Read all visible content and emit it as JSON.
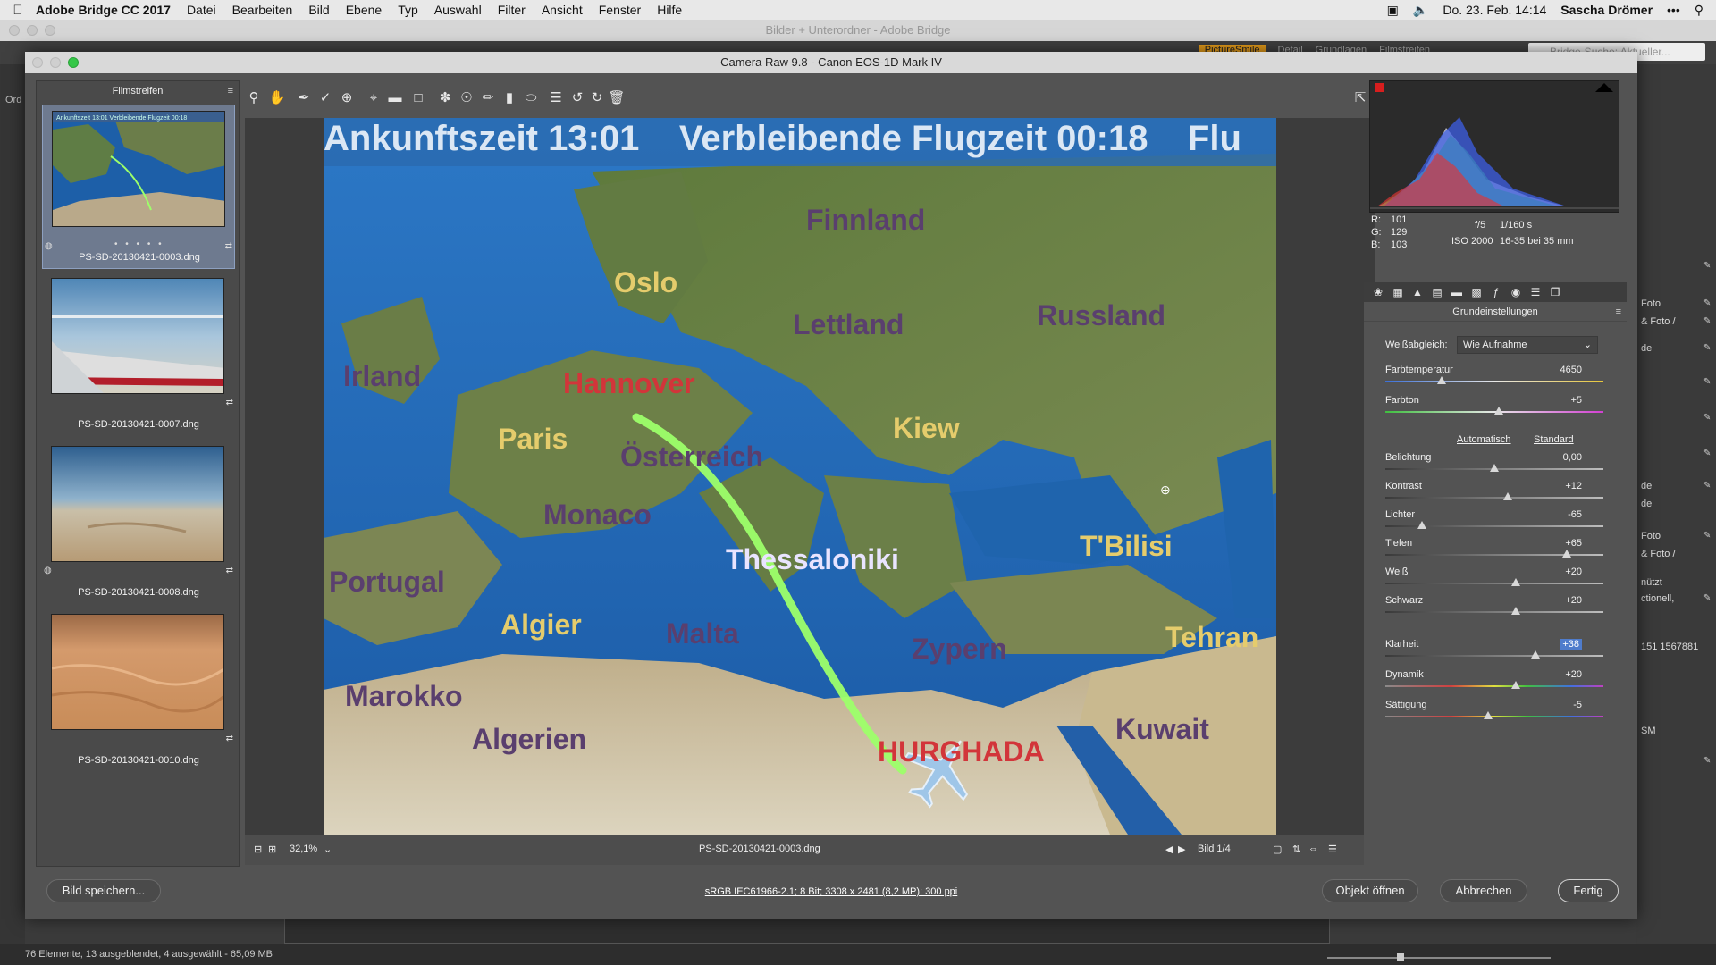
{
  "menubar": {
    "app": "Adobe Bridge CC 2017",
    "items": [
      "Datei",
      "Bearbeiten",
      "Bild",
      "Ebene",
      "Typ",
      "Auswahl",
      "Filter",
      "Ansicht",
      "Fenster",
      "Hilfe"
    ],
    "datetime": "Do. 23. Feb. 14:14",
    "user": "Sascha Drömer"
  },
  "bridge": {
    "title": "Bilder + Unterordner - Adobe Bridge",
    "tabs": [
      "PictureSmile",
      "Detail",
      "Grundlagen",
      "Filmstreifen"
    ],
    "search_placeholder": "Bridge-Suche: Aktueller...",
    "left_label": "Ord",
    "right_texts": [
      "Foto",
      "& Foto /",
      "de",
      "de",
      "de",
      "Foto",
      "& Foto /",
      "nützt",
      "ctionell,",
      "151 1567881",
      "SM"
    ],
    "status": "76 Elemente, 13 ausgeblendet, 4 ausgewählt - 65,09 MB"
  },
  "acr": {
    "title": "Camera Raw 9.8 - Canon EOS-1D Mark IV",
    "filmstrip_title": "Filmstreifen",
    "thumbs": [
      {
        "name": "PS-SD-20130421-0003.dng",
        "selected": true
      },
      {
        "name": "PS-SD-20130421-0007.dng",
        "selected": false
      },
      {
        "name": "PS-SD-20130421-0008.dng",
        "selected": false
      },
      {
        "name": "PS-SD-20130421-0010.dng",
        "selected": false
      }
    ],
    "photo": {
      "banner": "Ankunftszeit 13:01    Verbleibende Flugzeit 00:18    Flu",
      "labels": [
        {
          "id": "finnland",
          "text": "Finnland"
        },
        {
          "id": "oslo",
          "text": "Oslo"
        },
        {
          "id": "russland",
          "text": "Russland"
        },
        {
          "id": "lettland",
          "text": "Lettland"
        },
        {
          "id": "irland",
          "text": "Irland"
        },
        {
          "id": "hannover",
          "text": "Hannover"
        },
        {
          "id": "paris",
          "text": "Paris"
        },
        {
          "id": "oesterreich",
          "text": "Österreich"
        },
        {
          "id": "kiew",
          "text": "Kiew"
        },
        {
          "id": "monaco",
          "text": "Monaco"
        },
        {
          "id": "thessaloniki",
          "text": "Thessaloniki"
        },
        {
          "id": "tbilisi",
          "text": "T'Bilisi"
        },
        {
          "id": "portugal",
          "text": "Portugal"
        },
        {
          "id": "algier",
          "text": "Algier"
        },
        {
          "id": "malta",
          "text": "Malta"
        },
        {
          "id": "zypern",
          "text": "Zypern"
        },
        {
          "id": "tehran",
          "text": "Tehran"
        },
        {
          "id": "marokko",
          "text": "Marokko"
        },
        {
          "id": "algerien",
          "text": "Algerien"
        },
        {
          "id": "hurghada",
          "text": "HURGHADA"
        },
        {
          "id": "kuwait",
          "text": "Kuwait"
        }
      ]
    },
    "zoom": "32,1%",
    "filename": "PS-SD-20130421-0003.dng",
    "image_counter": "Bild 1/4",
    "rgb": {
      "r_label": "R:",
      "r": "101",
      "g_label": "G:",
      "g": "129",
      "b_label": "B:",
      "b": "103"
    },
    "exif": {
      "aperture": "f/5",
      "shutter": "1/160 s",
      "iso": "ISO 2000",
      "lens": "16-35 bei 35 mm"
    },
    "panel": {
      "title": "Grundeinstellungen",
      "wb_label": "Weißabgleich:",
      "wb_value": "Wie Aufnahme",
      "auto_link": "Automatisch",
      "standard_link": "Standard",
      "sliders": [
        {
          "id": "farbtemperatur",
          "label": "Farbtemperatur",
          "value": "4650",
          "pos": 0.26,
          "track": "temp"
        },
        {
          "id": "farbton",
          "label": "Farbton",
          "value": "+5",
          "pos": 0.52,
          "track": "tint"
        },
        {
          "id": "belichtung",
          "label": "Belichtung",
          "value": "0,00",
          "pos": 0.5,
          "track": "plain"
        },
        {
          "id": "kontrast",
          "label": "Kontrast",
          "value": "+12",
          "pos": 0.56,
          "track": "plain"
        },
        {
          "id": "lichter",
          "label": "Lichter",
          "value": "-65",
          "pos": 0.17,
          "track": "plain"
        },
        {
          "id": "tiefen",
          "label": "Tiefen",
          "value": "+65",
          "pos": 0.83,
          "track": "plain"
        },
        {
          "id": "weiss",
          "label": "Weiß",
          "value": "+20",
          "pos": 0.6,
          "track": "plain"
        },
        {
          "id": "schwarz",
          "label": "Schwarz",
          "value": "+20",
          "pos": 0.6,
          "track": "plain"
        },
        {
          "id": "klarheit",
          "label": "Klarheit",
          "value": "+38",
          "pos": 0.69,
          "track": "plain",
          "highlight": true
        },
        {
          "id": "dynamik",
          "label": "Dynamik",
          "value": "+20",
          "pos": 0.6,
          "track": "sat"
        },
        {
          "id": "saettigung",
          "label": "Sättigung",
          "value": "-5",
          "pos": 0.47,
          "track": "sat"
        }
      ]
    },
    "buttons": {
      "save": "Bild speichern...",
      "open": "Objekt öffnen",
      "cancel": "Abbrechen",
      "done": "Fertig"
    },
    "workflow_info": "sRGB IEC61966-2.1; 8 Bit; 3308 x 2481 (8,2 MP); 300 ppi"
  },
  "colors": {
    "accent_orange": "#e49b1a",
    "selection_blue": "#4f7ccc",
    "route_green": "#9dff6a"
  }
}
